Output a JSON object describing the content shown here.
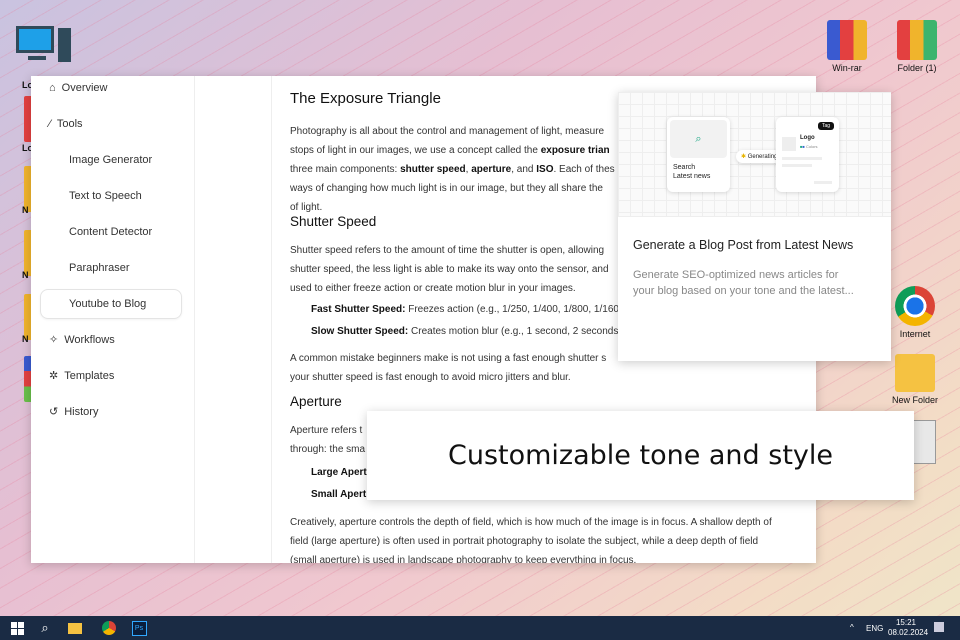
{
  "desktop": {
    "right_icons": [
      {
        "label": "Win-rar"
      },
      {
        "label": "Folder (1)"
      },
      {
        "label": "Internet"
      },
      {
        "label": "New Folder"
      }
    ],
    "left_labels": [
      "Lo",
      "Lo",
      "N",
      "N",
      "N"
    ]
  },
  "sidebar": {
    "items": [
      {
        "label": "Overview",
        "icon": "home-icon"
      },
      {
        "label": "Tools",
        "icon": "magic-wand-icon"
      },
      {
        "label": "Image Generator"
      },
      {
        "label": "Text to Speech"
      },
      {
        "label": "Content Detector"
      },
      {
        "label": "Paraphraser"
      },
      {
        "label": "Youtube to Blog",
        "active": true
      },
      {
        "label": "Workflows",
        "icon": "workflow-icon"
      },
      {
        "label": "Templates",
        "icon": "templates-icon"
      },
      {
        "label": "History",
        "icon": "history-icon"
      }
    ]
  },
  "article": {
    "title": "The Exposure Triangle",
    "intro": [
      "Photography is all about the control and management of light, measure",
      "stops of light in our images, we use a concept called the ",
      "exposure trian",
      "three main components: ",
      "shutter speed",
      ", ",
      "aperture",
      ", and ",
      "ISO",
      ". Each of thes",
      "ways of changing how much light is in our image, but they all share the",
      "of light."
    ],
    "h_shutter": "Shutter Speed",
    "shutter": [
      "Shutter speed refers to the amount of time the shutter is open, allowing",
      "shutter speed, the less light is able to make its way onto the sensor, and",
      "used to either freeze action or create motion blur in your images."
    ],
    "fast_label": "Fast Shutter Speed:",
    "fast_text": " Freezes action (e.g., 1/250, 1/400, 1/800, 1/160",
    "slow_label": "Slow Shutter Speed:",
    "slow_text": " Creates motion blur (e.g., 1 second, 2 seconds",
    "mistake": [
      "A common mistake beginners make is not using a fast enough shutter s",
      "your shutter speed is fast enough to avoid micro jitters and blur."
    ],
    "h_aperture": "Aperture",
    "aperture": [
      "Aperture refers t",
      "through: the sma"
    ],
    "large_label": "Large Apert",
    "small_label": "Small Apert",
    "creative": [
      "Creatively, aperture controls the depth of field, which is how much of the image is in focus. A shallow depth of",
      "field (large aperture) is often used in portrait photography to isolate the subject, while a deep depth of field",
      "(small aperture) is used in landscape photography to keep everything in focus."
    ]
  },
  "card": {
    "search_label": "Search",
    "search_sub": "Latest news",
    "generating": "Generating",
    "logo": "Logo",
    "tag": "Tag",
    "colors": "Colors",
    "title": "Generate a Blog Post from Latest News",
    "desc": [
      "Generate SEO-optimized news articles for",
      "your blog based on your tone and the latest..."
    ]
  },
  "banner": {
    "text": "Customizable tone and style"
  },
  "taskbar": {
    "lang": "ENG",
    "time": "15:21",
    "date": "08.02.2024"
  }
}
